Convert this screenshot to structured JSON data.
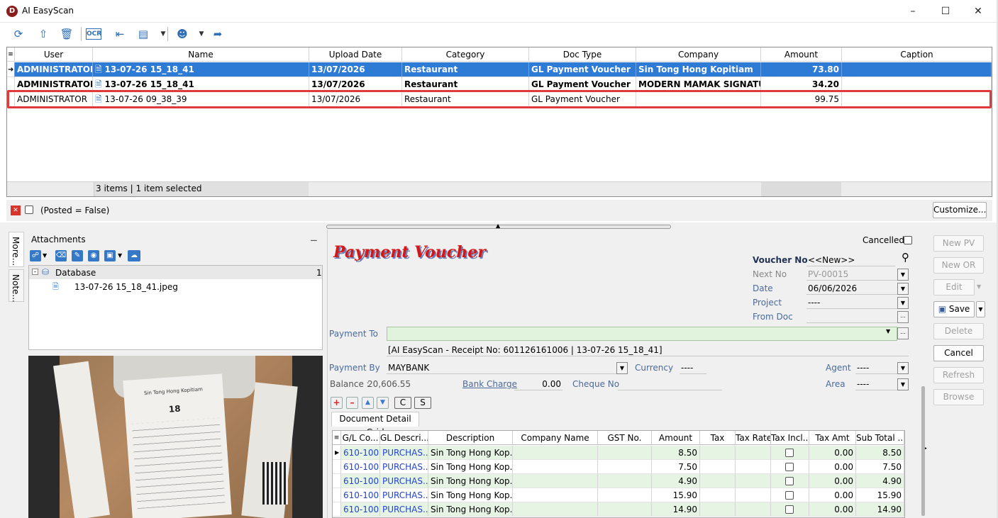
{
  "window": {
    "title": "AI EasyScan",
    "logo_letter": "D"
  },
  "toolbar": {
    "icons": [
      "refresh-icon",
      "upload-icon",
      "delete-icon",
      "ocr-icon",
      "split-icon",
      "layout-icon",
      "user-icon",
      "share-icon"
    ],
    "ocr_text": "OCR"
  },
  "main_grid": {
    "columns": [
      "User",
      "Name",
      "Upload Date",
      "Category",
      "Doc Type",
      "Company",
      "Amount",
      "Caption"
    ],
    "rows": [
      {
        "user": "ADMINISTRATOR",
        "name": "13-07-26 15_18_41",
        "date": "13/07/2026",
        "category": "Restaurant",
        "doctype": "GL Payment Voucher",
        "company": "Sin Tong Hong Kopitiam",
        "amount": "73.80",
        "caption": "",
        "state": "selected"
      },
      {
        "user": "ADMINISTRATOR",
        "name": "13-07-26 15_18_41",
        "date": "13/07/2026",
        "category": "Restaurant",
        "doctype": "GL Payment Voucher",
        "company": "MODERN MAMAK SIGNATURE",
        "amount": "34.20",
        "caption": "",
        "state": "bold"
      },
      {
        "user": "ADMINISTRATOR",
        "name": "13-07-26 09_38_39",
        "date": "13/07/2026",
        "category": "Restaurant",
        "doctype": "GL Payment Voucher",
        "company": "",
        "amount": "99.75",
        "caption": "",
        "state": "highlighted"
      }
    ],
    "status": "3 items |  1 item selected"
  },
  "filter": {
    "text": "(Posted = False)",
    "customize": "Customize..."
  },
  "side_tabs": [
    "More...",
    "Note..."
  ],
  "attachments": {
    "title": "Attachments",
    "tree_root": "Database",
    "tree_count": "1",
    "file": "13-07-26 15_18_41.jpeg"
  },
  "receipt_image": {
    "shop": "Sin Tong Hong Kopitiam",
    "table_no": "18"
  },
  "voucher": {
    "title": "Payment Voucher",
    "cancelled_label": "Cancelled",
    "voucher_no_label": "Voucher No",
    "voucher_no": "<<New>>",
    "next_no_label": "Next No",
    "next_no": "PV-00015",
    "date_label": "Date",
    "date": "06/06/2026",
    "project_label": "Project",
    "project": "----",
    "from_doc_label": "From Doc",
    "from_doc": "",
    "payment_to_label": "Payment To",
    "payment_to": "",
    "description": "[AI EasyScan - Receipt No: 601126161006 | 13-07-26 15_18_41]",
    "payment_by_label": "Payment By",
    "payment_by": "MAYBANK",
    "currency_label": "Currency",
    "currency": "----",
    "agent_label": "Agent",
    "agent": "----",
    "balance_label": "Balance :",
    "balance": "20,606.55",
    "bank_charge_label": "Bank Charge",
    "bank_charge": "0.00",
    "cheque_no_label": "Cheque No",
    "cheque_no": "",
    "area_label": "Area",
    "area": "----",
    "grid_tab": "Document Detail Grid",
    "c_btn": "C",
    "s_btn": "S"
  },
  "detail_grid": {
    "columns": [
      "G/L Co...",
      "GL Descri...",
      "Description",
      "Company Name",
      "GST No.",
      "Amount",
      "Tax",
      "Tax Rate",
      "Tax Incl...",
      "Tax Amt",
      "Sub Total ..."
    ],
    "rows": [
      {
        "gl": "610-100",
        "gldesc": "PURCHAS...",
        "desc": "Sin Tong Hong Kop...",
        "amount": "8.50",
        "taxamt": "0.00",
        "subtotal": "8.50"
      },
      {
        "gl": "610-100",
        "gldesc": "PURCHAS...",
        "desc": "Sin Tong Hong Kop...",
        "amount": "7.50",
        "taxamt": "0.00",
        "subtotal": "7.50"
      },
      {
        "gl": "610-100",
        "gldesc": "PURCHAS...",
        "desc": "Sin Tong Hong Kop...",
        "amount": "4.90",
        "taxamt": "0.00",
        "subtotal": "4.90"
      },
      {
        "gl": "610-100",
        "gldesc": "PURCHAS...",
        "desc": "Sin Tong Hong Kop...",
        "amount": "15.90",
        "taxamt": "0.00",
        "subtotal": "15.90"
      },
      {
        "gl": "610-100",
        "gldesc": "PURCHAS...",
        "desc": "Sin Tong Hong Kop...",
        "amount": "14.90",
        "taxamt": "0.00",
        "subtotal": "14.90"
      }
    ]
  },
  "actions": {
    "new_pv": "New PV",
    "new_or": "New OR",
    "edit": "Edit",
    "save": "Save",
    "delete": "Delete",
    "cancel": "Cancel",
    "refresh": "Refresh",
    "browse": "Browse"
  },
  "colors": {
    "selected_row": "#2e7bd6",
    "highlight_border": "#e03a3a",
    "green_row": "#e6f4e4",
    "title_red": "#d41818"
  }
}
